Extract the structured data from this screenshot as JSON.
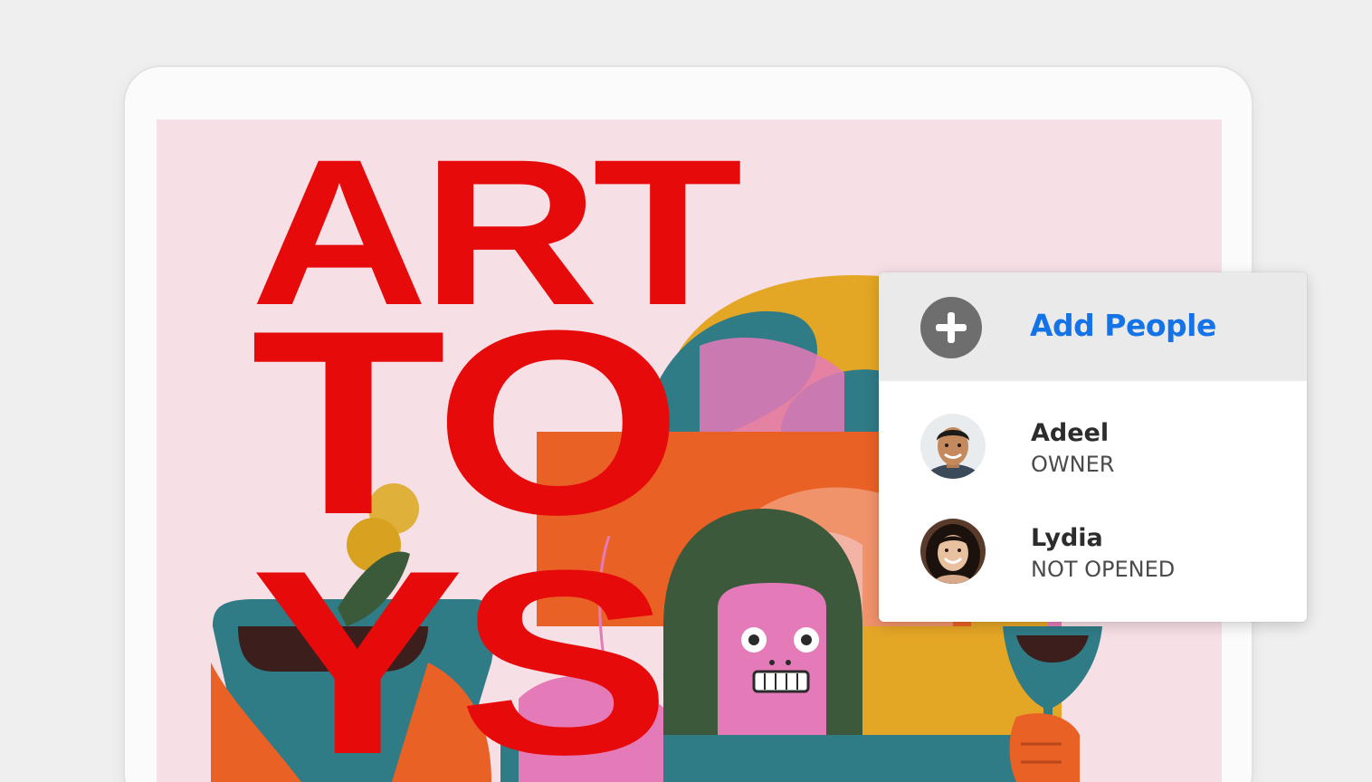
{
  "poster": {
    "line1": "ART",
    "line2": "TO",
    "line3": "YS"
  },
  "share_panel": {
    "add_label": "Add People",
    "people": [
      {
        "name": "Adeel",
        "status": "OWNER"
      },
      {
        "name": "Lydia",
        "status": "NOT OPENED"
      }
    ]
  },
  "colors": {
    "accent": "#1473e6",
    "poster_red": "#e60a0a",
    "poster_bg": "#f7dfe6"
  },
  "icons": {
    "add": "plus-circle-icon"
  }
}
